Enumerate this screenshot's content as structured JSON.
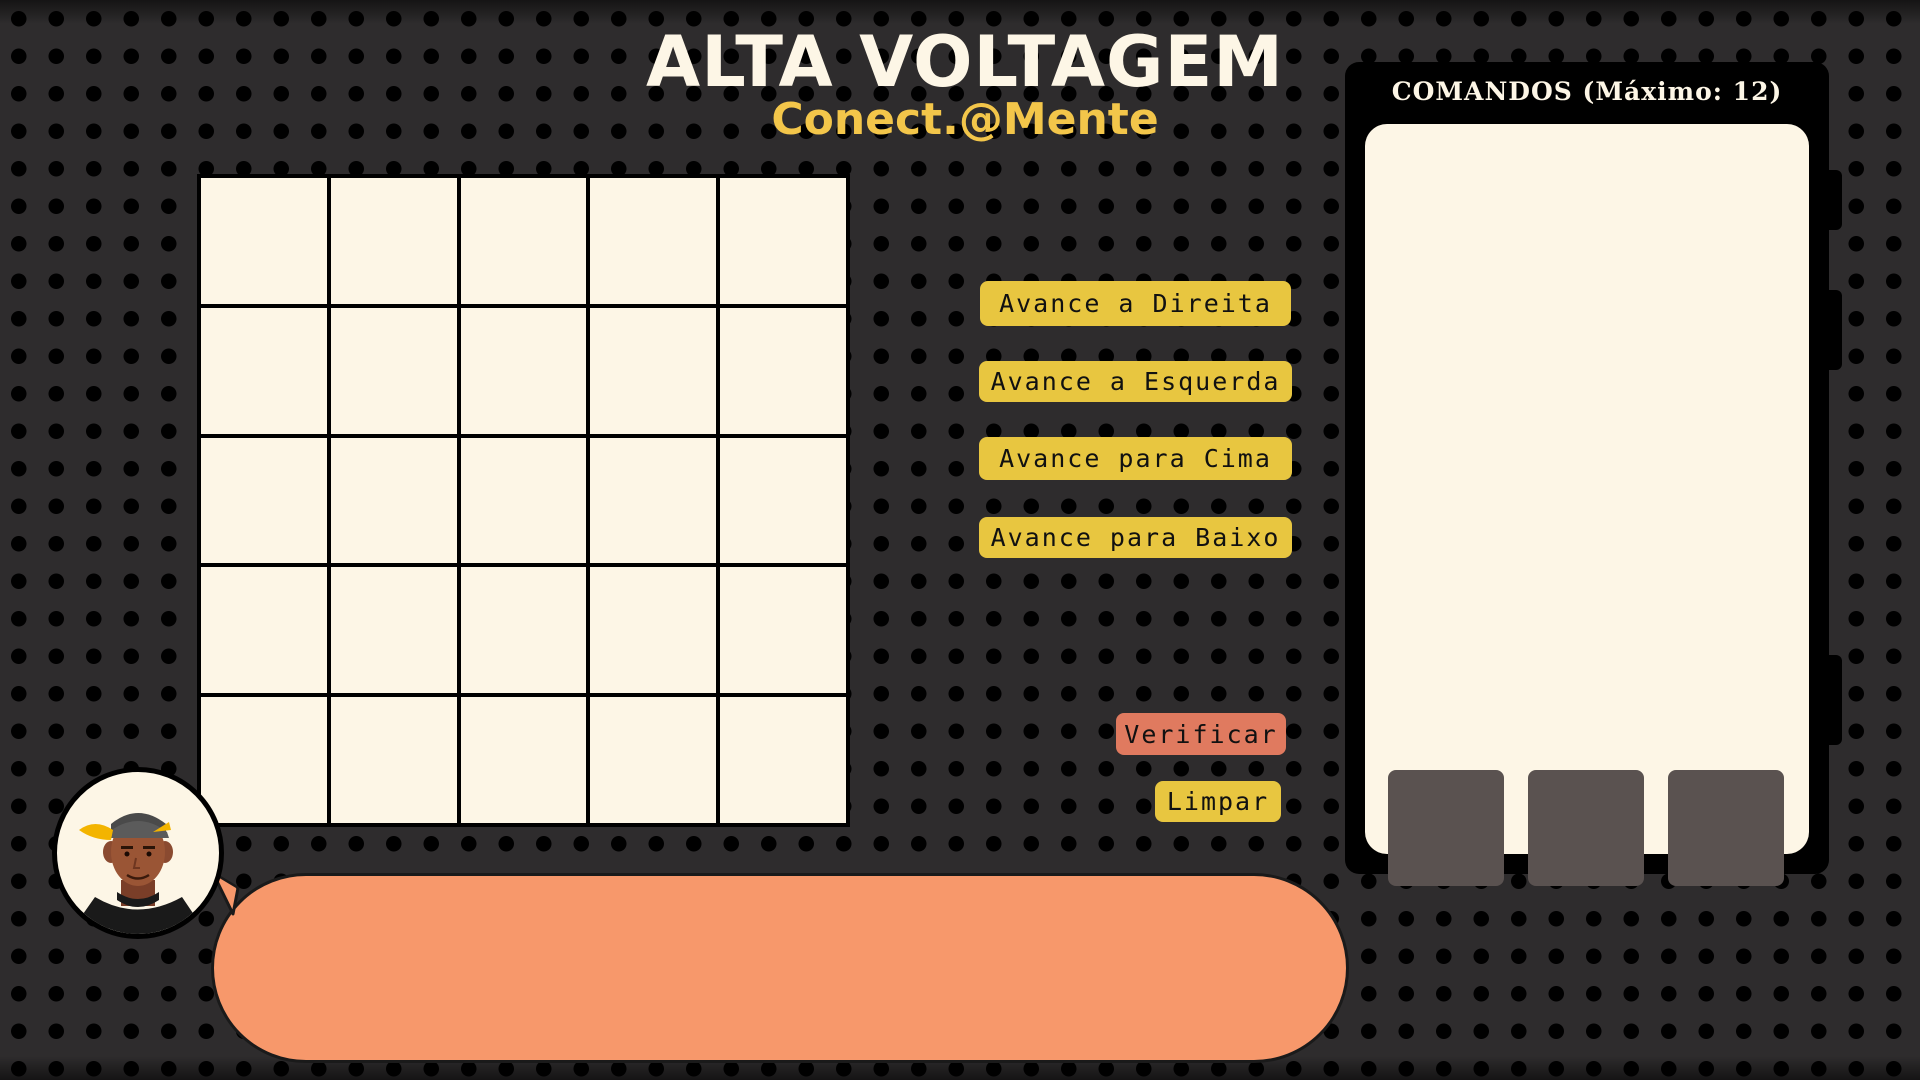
{
  "header": {
    "title": "ALTA VOLTAGEM",
    "subtitle": "Conect.@Mente"
  },
  "colors": {
    "background": "#2e2c2d",
    "dots": "#000000",
    "cell": "#fdf6e6",
    "title": "#fdf6e6",
    "subtitle": "#f3c64a",
    "command_button": "#e8c640",
    "verify_button": "#e07a5f",
    "clear_button": "#e8c640",
    "slot": "#5a5250",
    "speech_bubble": "#f7986b"
  },
  "board": {
    "rows": 5,
    "columns": 5
  },
  "controls": {
    "right": "Avance a Direita",
    "left": "Avance a Esquerda",
    "up": "Avance para Cima",
    "down": "Avance para Baixo",
    "verify": "Verificar",
    "clear": "Limpar"
  },
  "commands_panel": {
    "title": "COMANDOS (Máximo: 12)",
    "commands": [],
    "slots": 3
  },
  "character": {
    "icon": "character-avatar-icon"
  },
  "speech": {
    "text": ""
  }
}
